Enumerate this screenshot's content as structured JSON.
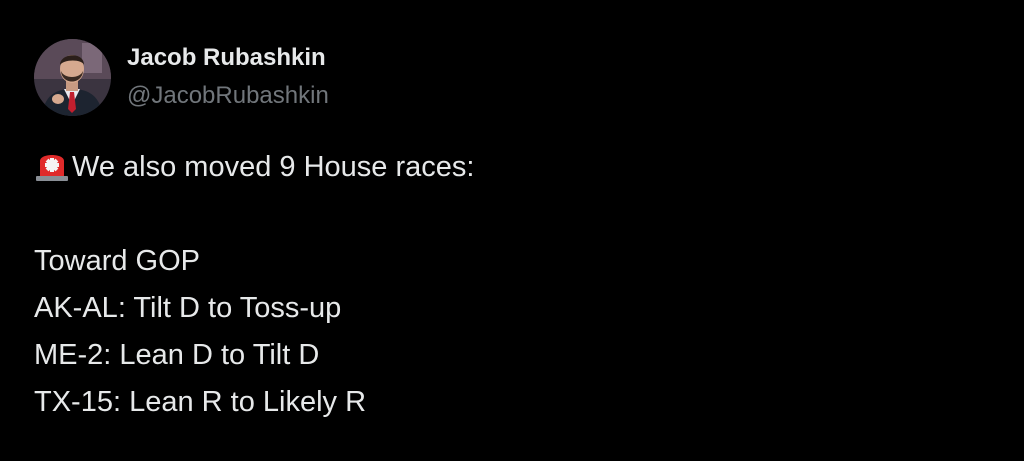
{
  "author": {
    "display_name": "Jacob Rubashkin",
    "handle": "@JacobRubashkin"
  },
  "tweet": {
    "emoji_icon": "police-car-light-icon",
    "intro": "We also moved 9 House races:",
    "lines": [
      "Toward GOP",
      "AK-AL: Tilt D to Toss-up",
      "ME-2: Lean D to Tilt D",
      "TX-15: Lean R to Likely R"
    ]
  },
  "colors": {
    "background": "#000000",
    "primary_text": "#e7e9ea",
    "secondary_text": "#71767b",
    "siren_red": "#e02a2a"
  }
}
